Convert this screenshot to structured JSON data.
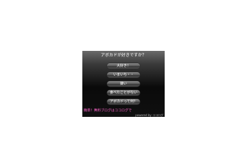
{
  "poll": {
    "question": "アボカドが好きですか？",
    "options": [
      {
        "label": "大好き！"
      },
      {
        "label": "いまいち・・"
      },
      {
        "label": "嫌い"
      },
      {
        "label": "食べたことがない"
      },
      {
        "label": "アボカドって何？"
      }
    ]
  },
  "footer": {
    "promo_text": "簡単！無料ブログはココログで",
    "credit_text": "powered by ココログ"
  },
  "colors": {
    "promo": "#ff66cc",
    "background_top": "#6a6a6a",
    "background_bottom": "#101010"
  }
}
